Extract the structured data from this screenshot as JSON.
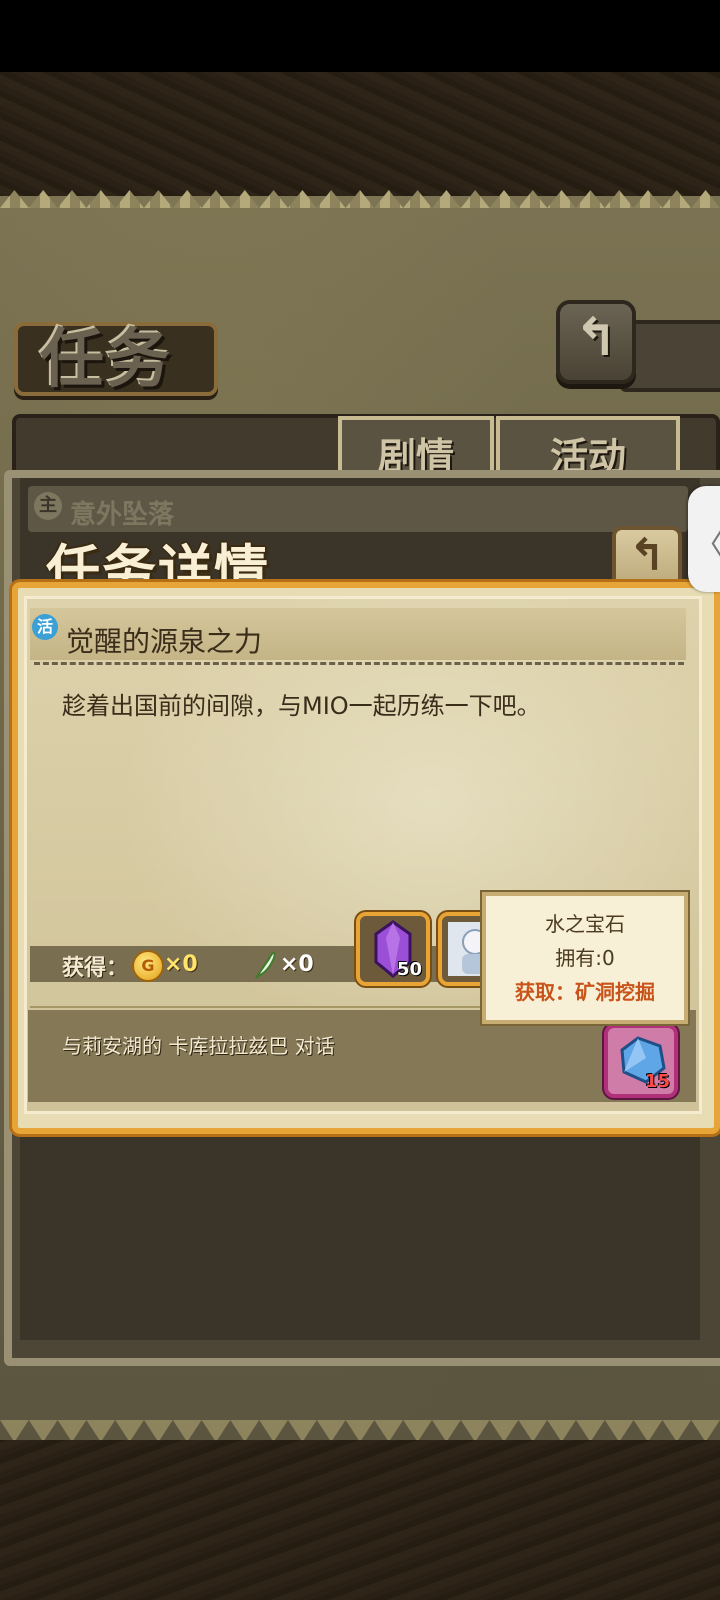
{
  "screen": {
    "title": "任务",
    "back_glyph": "↰"
  },
  "tabs": [
    {
      "label": "剧情",
      "selected": true
    },
    {
      "label": "活动",
      "selected": false
    }
  ],
  "quest_list": {
    "row_badge": "主",
    "row_label": "意外坠落"
  },
  "detail": {
    "header": "任务详情",
    "back_glyph": "↰",
    "quest_badge": "活",
    "quest_name": "觉醒的源泉之力",
    "description": "趁着出国前的间隙，与MIO一起历练一下吧。",
    "reward_label": "获得：",
    "coin_icon": "G",
    "coin_count": "×0",
    "feather_count": "×0",
    "reward_items": [
      {
        "icon": "purple-crystal-icon",
        "count": "50"
      },
      {
        "icon": "character-portrait-icon",
        "count": ""
      }
    ],
    "objective": "与莉安湖的 卡库拉拉兹巴 对话",
    "objective_item": {
      "icon": "water-gem-icon",
      "count": "15"
    }
  },
  "tooltip": {
    "name": "水之宝石",
    "owned": "拥有:0",
    "source": "获取：矿洞挖掘"
  },
  "side_handle": {
    "glyph": "〈"
  },
  "colors": {
    "card_border": "#e7a437",
    "tooltip_source": "#c8541a",
    "coin_count": "#ffe36a"
  }
}
